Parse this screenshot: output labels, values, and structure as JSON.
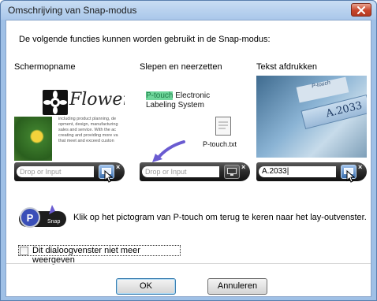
{
  "window": {
    "title": "Omschrijving van Snap-modus"
  },
  "intro": "De volgende functies kunnen worden gebruikt in de Snap-modus:",
  "panels": [
    {
      "label": "Schermopname",
      "image_title": "Flower",
      "image_desc": "including product planning, de opment, design, manufacturing sales and service. With the ac creating and providing more va that meet and exceed custon",
      "drop_placeholder": "Drop or Input"
    },
    {
      "label": "Slepen en neerzetten",
      "text_highlight": "P-touch",
      "text_line1": " Electronic",
      "text_line2": "Labeling System",
      "file_name": "P-touch.txt",
      "drop_placeholder": "Drop or Input"
    },
    {
      "label": "Tekst afdrukken",
      "tape_text": "A.2033",
      "label_sticker_text": "P-touch",
      "drop_value": "A.2033|"
    }
  ],
  "hint": {
    "icon_label": "Snap",
    "text": "Klik op het pictogram van P-touch om terug te keren naar het lay-outvenster."
  },
  "checkbox": {
    "label": "Dit dialoogvenster niet meer weergeven",
    "checked": false
  },
  "buttons": {
    "ok": "OK",
    "cancel": "Annuleren"
  },
  "colors": {
    "title_bar": "#a9c7ea",
    "close_button": "#c8452b",
    "highlight": "#6fd69b",
    "default_button_border": "#3c7fb1"
  }
}
